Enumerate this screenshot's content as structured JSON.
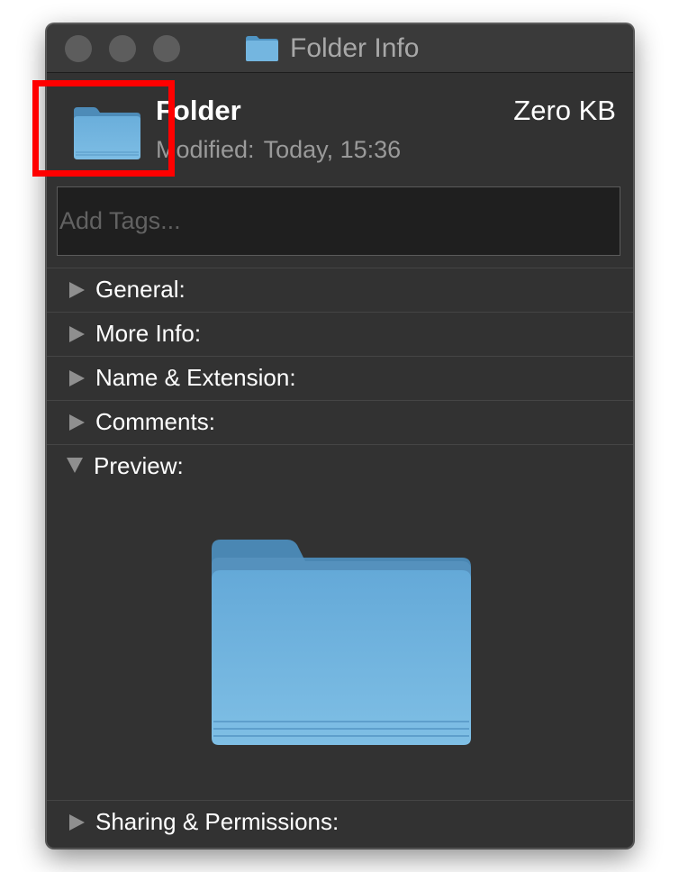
{
  "window": {
    "title": "Folder Info",
    "title_icon": "folder-icon"
  },
  "header": {
    "name": "Folder",
    "size": "Zero KB",
    "modified_label": "Modified:",
    "modified_value": "Today, 15:36",
    "icon": "folder-icon"
  },
  "tags": {
    "placeholder": "Add Tags...",
    "value": ""
  },
  "sections": [
    {
      "label": "General:",
      "expanded": false
    },
    {
      "label": "More Info:",
      "expanded": false
    },
    {
      "label": "Name & Extension:",
      "expanded": false
    },
    {
      "label": "Comments:",
      "expanded": false
    },
    {
      "label": "Preview:",
      "expanded": true
    },
    {
      "label": "Sharing & Permissions:",
      "expanded": false
    }
  ],
  "preview": {
    "icon": "folder-icon"
  },
  "colors": {
    "window_bg": "#323232",
    "folder_blue": "#6fb3de",
    "annotation_red": "#ff0000"
  }
}
